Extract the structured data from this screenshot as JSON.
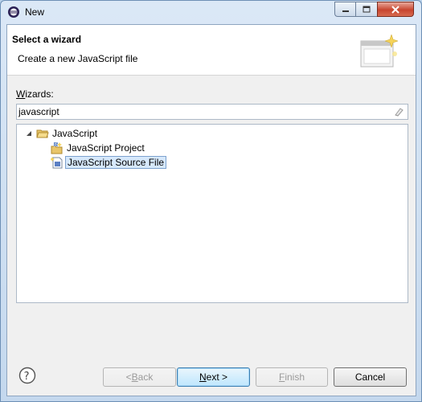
{
  "window": {
    "title": "New",
    "controls": {
      "minimize": "minimize",
      "maximize": "maximize",
      "close": "close"
    }
  },
  "header": {
    "title": "Select a wizard",
    "description": "Create a new JavaScript file"
  },
  "wizards": {
    "label_prefix": "W",
    "label_rest": "izards:",
    "filter_value": "javascript"
  },
  "tree": {
    "category": "JavaScript",
    "items": [
      {
        "label": "JavaScript Project",
        "selected": false
      },
      {
        "label": "JavaScript Source File",
        "selected": true
      }
    ]
  },
  "buttons": {
    "back_prefix": "< ",
    "back_mnemonic": "B",
    "back_rest": "ack",
    "next_mnemonic": "N",
    "next_rest": "ext >",
    "finish_mnemonic": "F",
    "finish_rest": "inish",
    "cancel": "Cancel"
  },
  "colors": {
    "window_frame": "#c4d8ee",
    "selection": "#d6e8fb",
    "close_button": "#c7452f"
  }
}
